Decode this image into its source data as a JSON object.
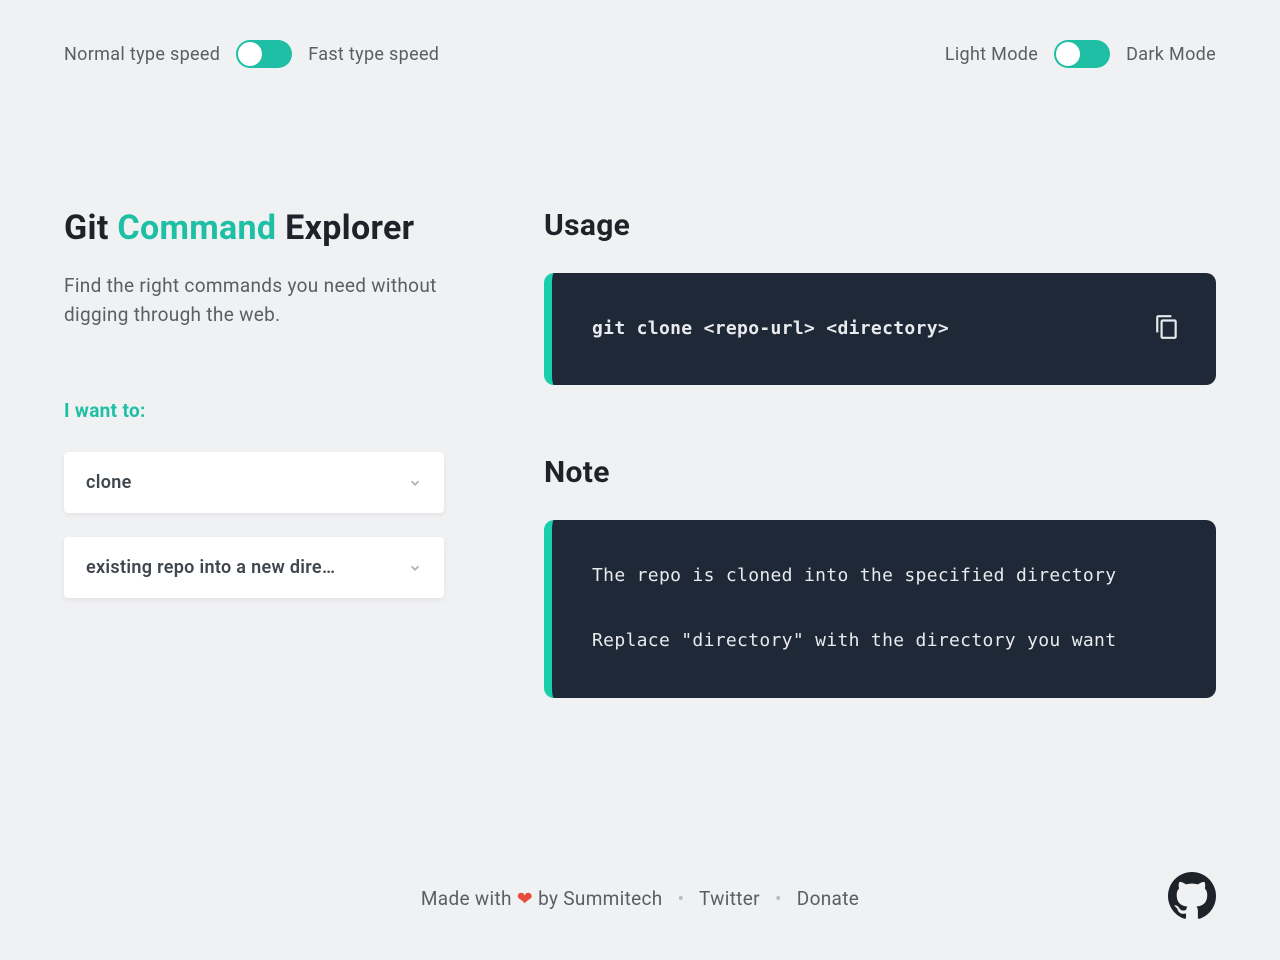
{
  "topbar": {
    "speed_left": "Normal type speed",
    "speed_right": "Fast type speed",
    "theme_left": "Light Mode",
    "theme_right": "Dark Mode"
  },
  "title": {
    "part1": "Git ",
    "accent": "Command",
    "part2": " Explorer"
  },
  "subtitle": "Find the right commands you need without digging through the web.",
  "prompt_label": "I want to:",
  "dropdowns": {
    "first": "clone",
    "second": "existing repo into a new dire…"
  },
  "usage": {
    "heading": "Usage",
    "code": "git clone <repo-url> <directory>"
  },
  "note": {
    "heading": "Note",
    "line1": "The repo is cloned into the specified directory",
    "line2": "Replace \"directory\" with the directory you want"
  },
  "footer": {
    "made_with": "Made with ",
    "by": " by Summitech",
    "twitter": "Twitter",
    "donate": "Donate"
  }
}
